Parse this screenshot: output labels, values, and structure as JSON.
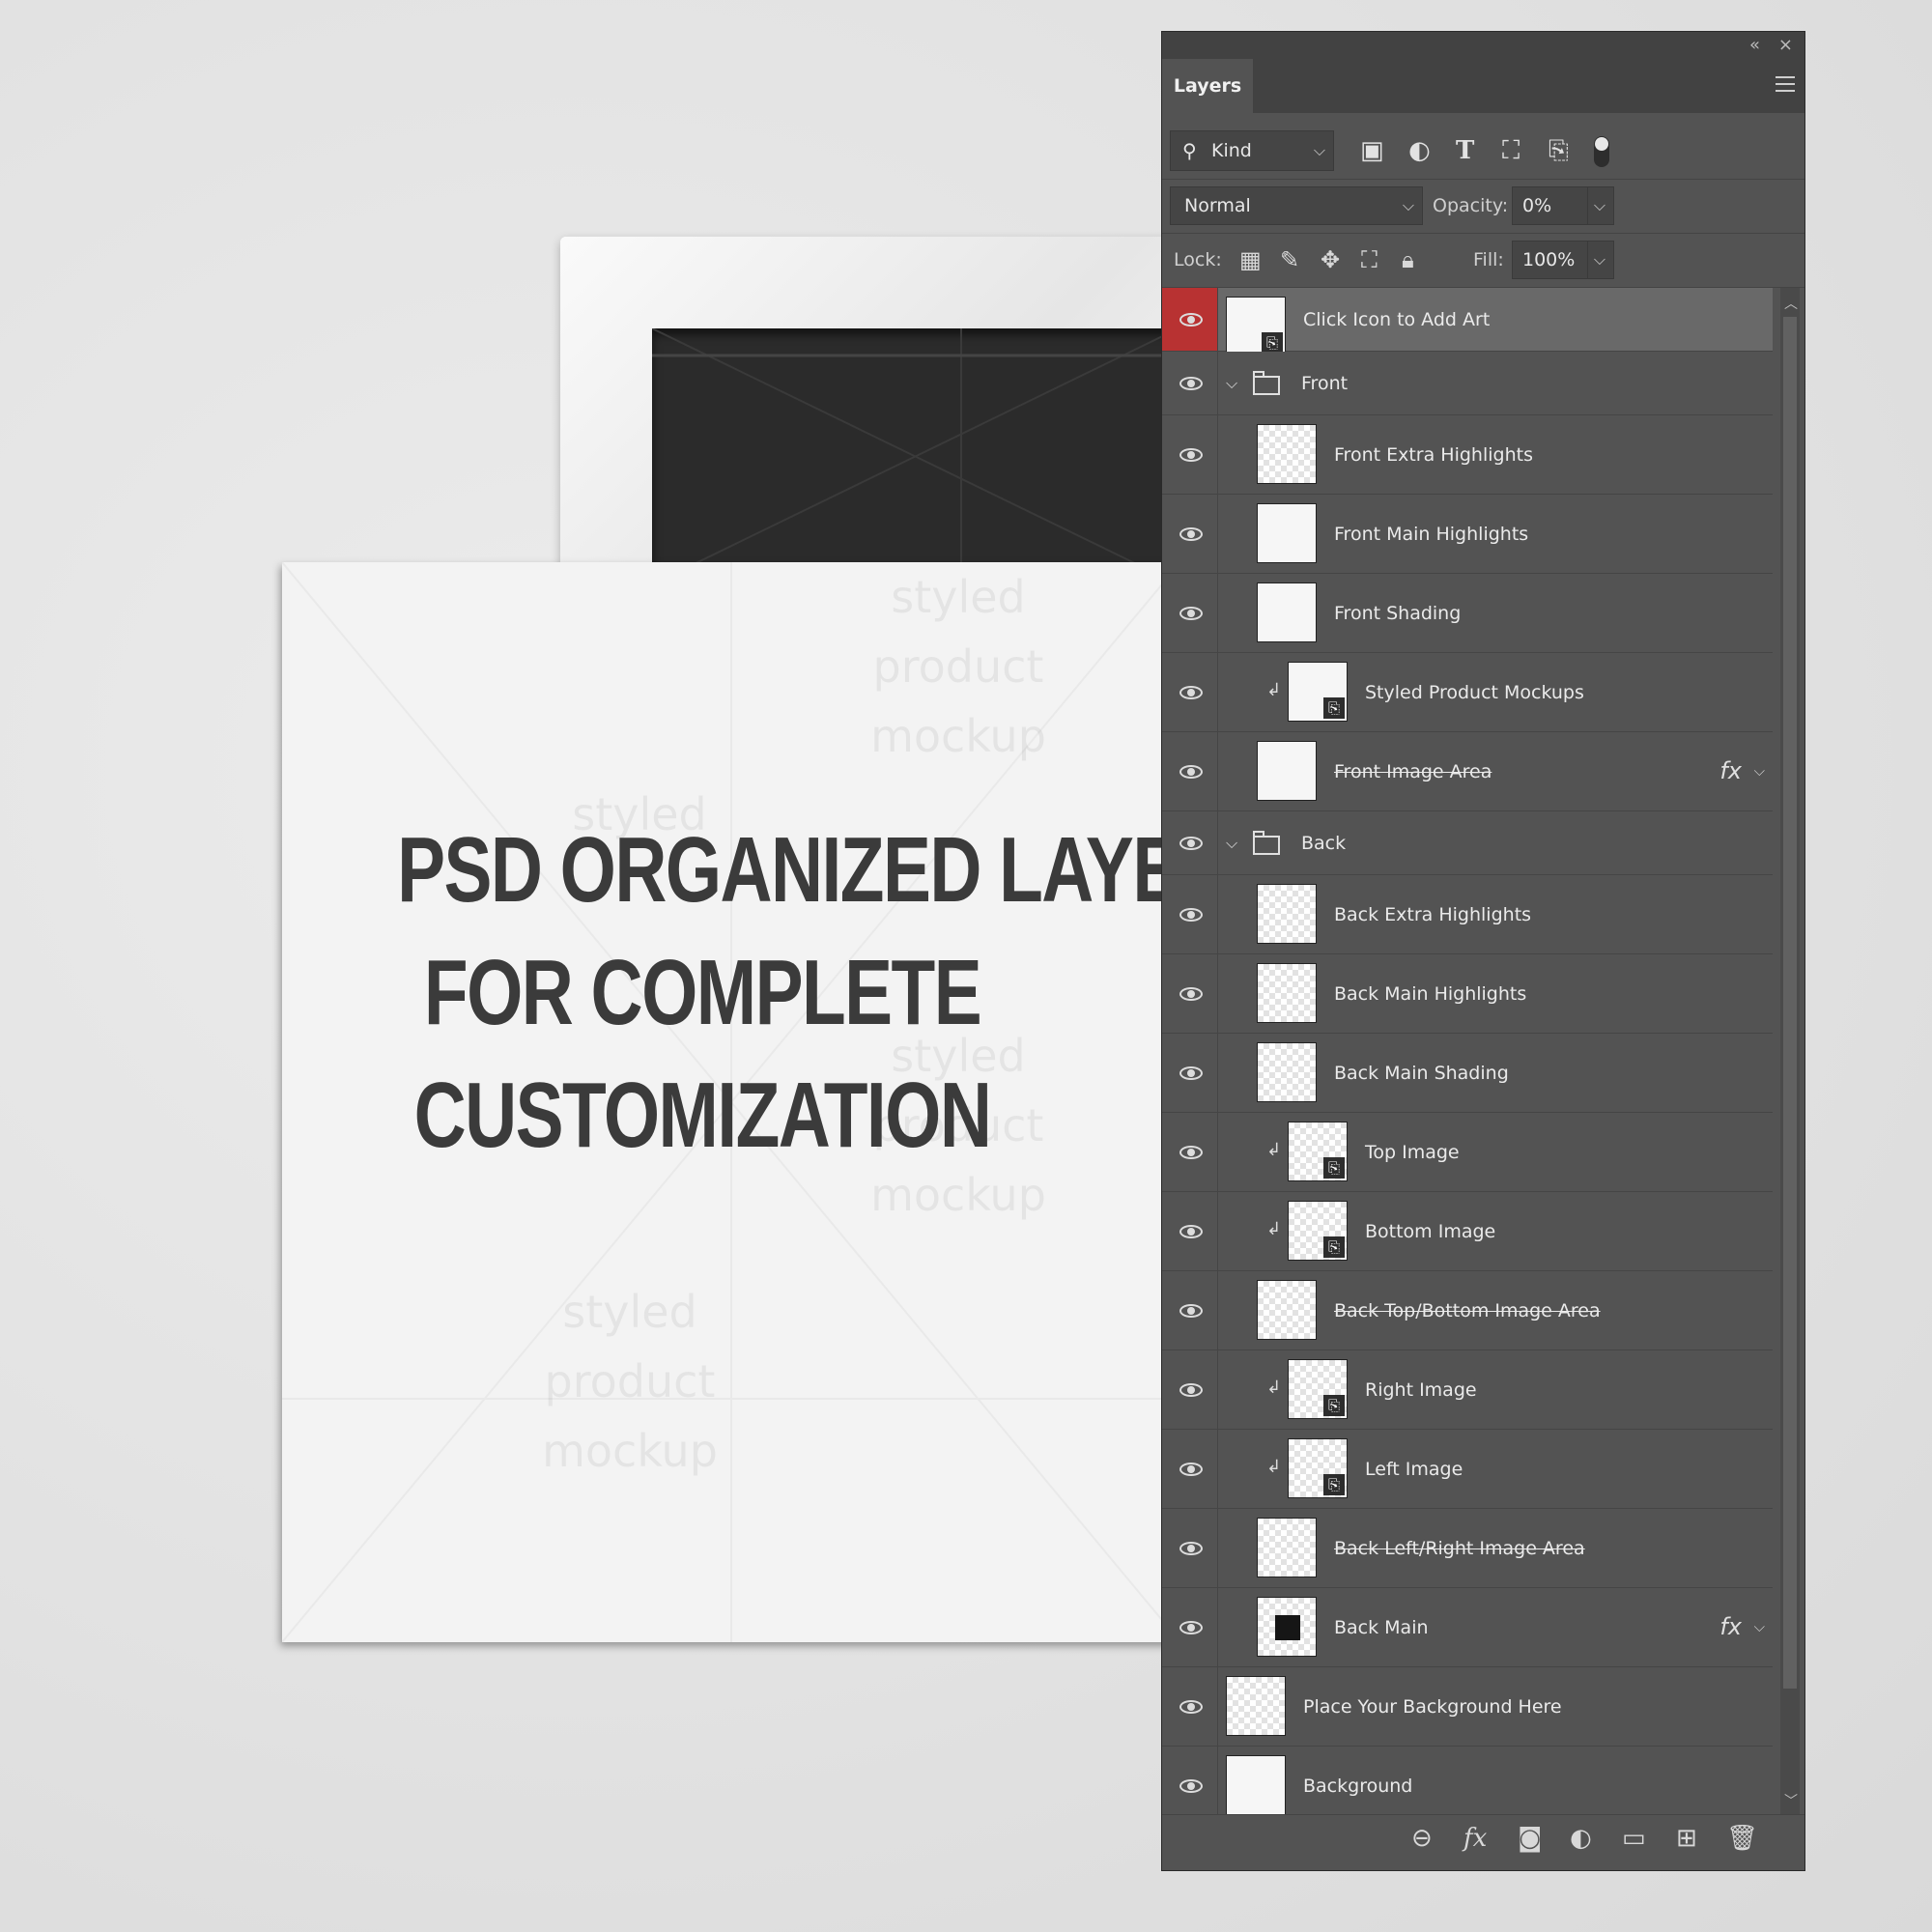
{
  "mockup": {
    "headline": [
      "PSD ORGANIZED LAYERS",
      "FOR COMPLETE",
      "CUSTOMIZATION"
    ],
    "watermark_lines": [
      "styled",
      "product",
      "mockup"
    ]
  },
  "panel": {
    "collapse_glyph": "«",
    "close_glyph": "×",
    "tab_label": "Layers",
    "filter": {
      "kind_label": "Kind",
      "icons": [
        "image-filter-icon",
        "adjustment-filter-icon",
        "type-filter-icon",
        "shape-filter-icon",
        "smart-object-filter-icon"
      ]
    },
    "blend_mode": "Normal",
    "opacity_label": "Opacity:",
    "opacity_value": "0%",
    "lock_label": "Lock:",
    "fill_label": "Fill:",
    "fill_value": "100%",
    "layers": [
      {
        "name": "Click Icon to Add Art",
        "indent": 0,
        "thumb": "white",
        "smart": true,
        "selected": true
      },
      {
        "name": "Front",
        "indent": 0,
        "group": true
      },
      {
        "name": "Front Extra Highlights",
        "indent": 1,
        "thumb": "checker"
      },
      {
        "name": "Front Main Highlights",
        "indent": 1,
        "thumb": "white"
      },
      {
        "name": "Front Shading",
        "indent": 1,
        "thumb": "white"
      },
      {
        "name": "Styled Product Mockups",
        "indent": 2,
        "thumb": "white",
        "smart": true,
        "clip": true
      },
      {
        "name": "Front Image Area",
        "indent": 1,
        "thumb": "white",
        "strike": true,
        "fx": true
      },
      {
        "name": "Back",
        "indent": 0,
        "group": true
      },
      {
        "name": "Back Extra Highlights",
        "indent": 1,
        "thumb": "checker"
      },
      {
        "name": "Back Main Highlights",
        "indent": 1,
        "thumb": "checker"
      },
      {
        "name": "Back Main Shading",
        "indent": 1,
        "thumb": "checker"
      },
      {
        "name": "Top Image",
        "indent": 2,
        "thumb": "checker",
        "smart": true,
        "clip": true
      },
      {
        "name": "Bottom Image",
        "indent": 2,
        "thumb": "checker",
        "smart": true,
        "clip": true
      },
      {
        "name": "Back Top/Bottom Image Area",
        "indent": 1,
        "thumb": "checker",
        "strike": true
      },
      {
        "name": "Right Image",
        "indent": 2,
        "thumb": "checker",
        "smart": true,
        "clip": true
      },
      {
        "name": "Left Image",
        "indent": 2,
        "thumb": "checker",
        "smart": true,
        "clip": true
      },
      {
        "name": "Back Left/Right Image Area",
        "indent": 1,
        "thumb": "checker",
        "strike": true
      },
      {
        "name": "Back Main",
        "indent": 1,
        "thumb": "dark",
        "fx": true
      },
      {
        "name": "Place Your Background Here",
        "indent": 0,
        "thumb": "checker"
      },
      {
        "name": "Background",
        "indent": 0,
        "thumb": "white"
      }
    ],
    "fx_glyph": "fx",
    "bottom_icons": [
      "link-layers-icon",
      "add-style-icon",
      "add-mask-icon",
      "new-adjustment-icon",
      "new-group-icon",
      "new-layer-icon",
      "delete-layer-icon"
    ]
  },
  "colors": {
    "panel_bg": "#535353",
    "selected_eye": "#b83232",
    "headline": "#3b3b3b"
  }
}
